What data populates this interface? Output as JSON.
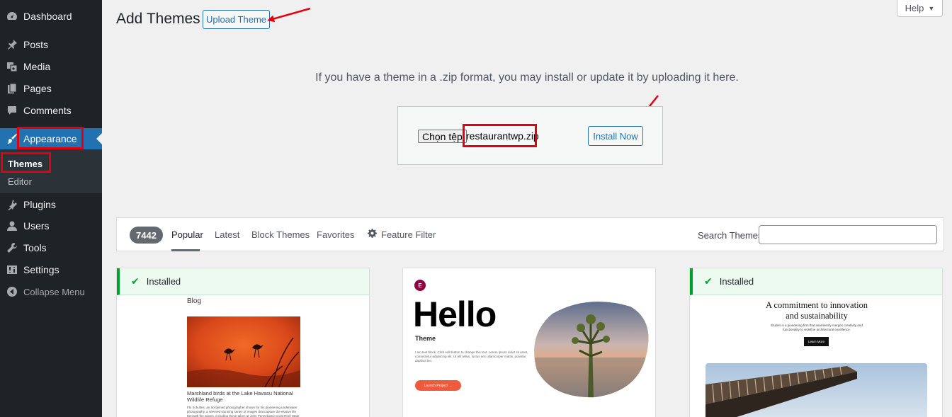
{
  "sidebar": {
    "items": [
      {
        "label": "Dashboard",
        "icon": "dashboard-icon"
      },
      {
        "label": "Posts",
        "icon": "pin-icon"
      },
      {
        "label": "Media",
        "icon": "media-icon"
      },
      {
        "label": "Pages",
        "icon": "pages-icon"
      },
      {
        "label": "Comments",
        "icon": "comment-icon"
      },
      {
        "label": "Appearance",
        "icon": "brush-icon"
      },
      {
        "label": "Plugins",
        "icon": "plugin-icon"
      },
      {
        "label": "Users",
        "icon": "user-icon"
      },
      {
        "label": "Tools",
        "icon": "wrench-icon"
      },
      {
        "label": "Settings",
        "icon": "settings-icon"
      },
      {
        "label": "Collapse Menu",
        "icon": "collapse-icon"
      }
    ],
    "submenu": [
      {
        "label": "Themes"
      },
      {
        "label": "Editor"
      }
    ]
  },
  "header": {
    "title": "Add Themes",
    "upload_label": "Upload Theme",
    "help_label": "Help"
  },
  "upload": {
    "description": "If you have a theme in a .zip format, you may install or update it by uploading it here.",
    "choose_file_label": "Chọn tệp",
    "file_name": "restaurantwp.zip",
    "install_label": "Install Now"
  },
  "filters": {
    "count": "7442",
    "tabs": [
      {
        "label": "Popular"
      },
      {
        "label": "Latest"
      },
      {
        "label": "Block Themes"
      },
      {
        "label": "Favorites"
      },
      {
        "label": "Feature Filter"
      }
    ],
    "search_label": "Search Themes",
    "search_value": ""
  },
  "themes": [
    {
      "installed_label": "Installed",
      "preview": {
        "heading": "Blog",
        "caption": "Marshland birds at the Lake Havasu National Wildlife Refuge",
        "body": "Flo Schultes, an acclaimed photographer shown for his pioneering underwater photography, a seemed stunning series of images that capture the elusive life beneath the waves, including those taken at John Pennekamp Coral Reef State"
      }
    },
    {
      "preview": {
        "badge": "E",
        "heading": "Hello",
        "subheading": "Theme",
        "body": "I am text block. Click edit button to change this text. Lorem ipsum dolor sit amet, consectetur adipiscing elit. Ut elit tellus, luctus nec ullamcorper mattis, pulvinar dapibus leo.",
        "button": "Launch Project →"
      }
    },
    {
      "installed_label": "Installed",
      "preview": {
        "heading_line1": "A commitment to innovation",
        "heading_line2": "and sustainability",
        "body": "Études is a pioneering firm that seamlessly merges creativity and functionality to redefine architectural excellence.",
        "button": "Learn More"
      }
    }
  ],
  "colors": {
    "sidebar_bg": "#1d2327",
    "accent": "#2271b1",
    "annotation": "#e2000f",
    "installed_green": "#00a32a"
  }
}
